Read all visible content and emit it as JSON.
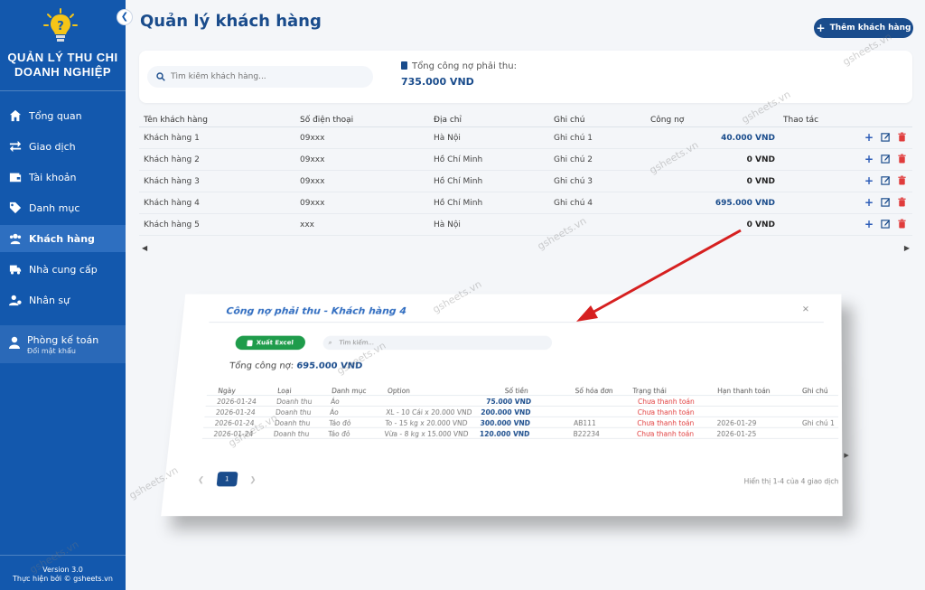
{
  "sidebar": {
    "brand_line1": "QUẢN LÝ THU CHI",
    "brand_line2": "DOANH NGHIỆP",
    "items": [
      {
        "label": "Tổng quan",
        "icon": "home-icon"
      },
      {
        "label": "Giao dịch",
        "icon": "exchange-icon"
      },
      {
        "label": "Tài khoản",
        "icon": "wallet-icon"
      },
      {
        "label": "Danh mục",
        "icon": "tag-icon"
      },
      {
        "label": "Khách hàng",
        "icon": "users-icon",
        "active": true
      },
      {
        "label": "Nhà cung cấp",
        "icon": "truck-icon"
      },
      {
        "label": "Nhân sự",
        "icon": "user-gear-icon"
      }
    ],
    "user": {
      "name": "Phòng kế toán",
      "sub": "Đổi mật khẩu"
    },
    "version": "Version 3.0",
    "credit": "Thực hiện bởi © gsheets.vn"
  },
  "header": {
    "title": "Quản lý khách hàng",
    "add_button": "Thêm khách hàng"
  },
  "filter": {
    "search_placeholder": "Tìm kiếm khách hàng...",
    "debt_label": "Tổng công nợ phải thu:",
    "debt_value": "735.000 VND"
  },
  "table": {
    "headers": [
      "Tên khách hàng",
      "Số điện thoại",
      "Địa chỉ",
      "Ghi chú",
      "Công nợ",
      "Thao tác"
    ],
    "rows": [
      {
        "name": "Khách hàng 1",
        "phone": "09xxx",
        "address": "Hà Nội",
        "note": "Ghi chú 1",
        "debt": "40.000 VND",
        "highlight": true
      },
      {
        "name": "Khách hàng 2",
        "phone": "09xxx",
        "address": "Hồ Chí Minh",
        "note": "Ghi chú 2",
        "debt": "0 VND",
        "highlight": false
      },
      {
        "name": "Khách hàng 3",
        "phone": "09xxx",
        "address": "Hồ Chí Minh",
        "note": "Ghi chú 3",
        "debt": "0 VND",
        "highlight": false
      },
      {
        "name": "Khách hàng 4",
        "phone": "09xxx",
        "address": "Hồ Chí Minh",
        "note": "Ghi chú 4",
        "debt": "695.000 VND",
        "highlight": true
      },
      {
        "name": "Khách hàng 5",
        "phone": "xxx",
        "address": "Hà Nội",
        "note": "",
        "debt": "0 VND",
        "highlight": false
      }
    ]
  },
  "popup": {
    "title": "Công nợ phải thu - Khách hàng 4",
    "close": "×",
    "export_button": "Xuất Excel",
    "search_placeholder": "Tìm kiếm...",
    "total_label": "Tổng công nợ:",
    "total_value": "695.000 VND",
    "headers": [
      "Ngày",
      "Loại",
      "Danh mục",
      "Option",
      "Số tiền",
      "Số hóa đơn",
      "Trạng thái",
      "Hạn thanh toán",
      "Ghi chú"
    ],
    "rows": [
      {
        "date": "2026-01-24",
        "type": "Doanh thu",
        "category": "Áo",
        "option": "",
        "amount": "75.000 VND",
        "invoice": "",
        "status": "Chưa thanh toán",
        "due": "",
        "note": ""
      },
      {
        "date": "2026-01-24",
        "type": "Doanh thu",
        "category": "Áo",
        "option": "XL - 10 Cái x 20.000 VND",
        "amount": "200.000 VND",
        "invoice": "",
        "status": "Chưa thanh toán",
        "due": "",
        "note": ""
      },
      {
        "date": "2026-01-24",
        "type": "Doanh thu",
        "category": "Táo đỏ",
        "option": "To - 15 kg x 20.000 VND",
        "amount": "300.000 VND",
        "invoice": "AB111",
        "status": "Chưa thanh toán",
        "due": "2026-01-29",
        "note": "Ghi chú 1"
      },
      {
        "date": "2026-01-24",
        "type": "Doanh thu",
        "category": "Táo đỏ",
        "option": "Vừa - 8 kg x 15.000 VND",
        "amount": "120.000 VND",
        "invoice": "B22234",
        "status": "Chưa thanh toán",
        "due": "2026-01-25",
        "note": ""
      }
    ],
    "page": "1",
    "info": "Hiển thị 1-4 của 4 giao dịch"
  },
  "watermark": "gsheets.vn",
  "colors": {
    "sidebar": "#1358ad",
    "primary": "#1a4c8c",
    "danger": "#e03c3c",
    "success": "#1f9c4b"
  }
}
